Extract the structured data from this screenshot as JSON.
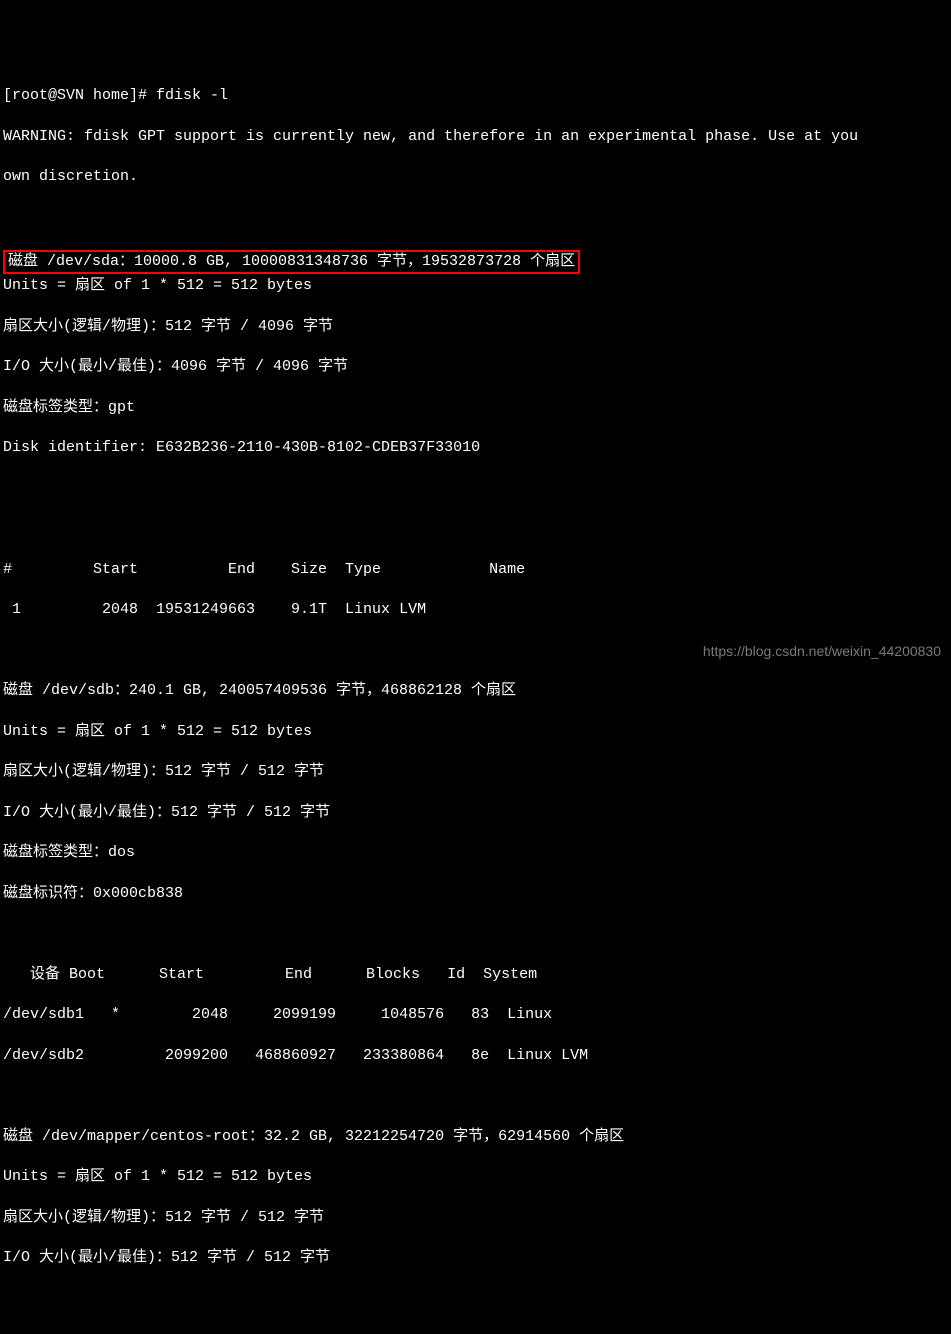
{
  "prompt": "[root@SVN home]# fdisk -l",
  "warning_line1": "WARNING: fdisk GPT support is currently new, and therefore in an experimental phase. Use at you",
  "warning_line2": "own discretion.",
  "sda_header": "磁盘 /dev/sda：10000.8 GB, 10000831348736 字节，19532873728 个扇区",
  "sda_units": "Units = 扇区 of 1 * 512 = 512 bytes",
  "sda_sector": "扇区大小(逻辑/物理)：512 字节 / 4096 字节",
  "sda_io": "I/O 大小(最小/最佳)：4096 字节 / 4096 字节",
  "sda_label": "磁盘标签类型：gpt",
  "sda_identifier": "Disk identifier: E632B236-2110-430B-8102-CDEB37F33010",
  "sda_table_header": "#         Start          End    Size  Type            Name",
  "sda_table_row1": " 1         2048  19531249663    9.1T  Linux LVM",
  "sdb_header": "磁盘 /dev/sdb：240.1 GB, 240057409536 字节，468862128 个扇区",
  "sdb_units": "Units = 扇区 of 1 * 512 = 512 bytes",
  "sdb_sector": "扇区大小(逻辑/物理)：512 字节 / 512 字节",
  "sdb_io": "I/O 大小(最小/最佳)：512 字节 / 512 字节",
  "sdb_label": "磁盘标签类型：dos",
  "sdb_identifier": "磁盘标识符：0x000cb838",
  "sdb_table_header": "   设备 Boot      Start         End      Blocks   Id  System",
  "sdb_table_row1": "/dev/sdb1   *        2048     2099199     1048576   83  Linux",
  "sdb_table_row2": "/dev/sdb2         2099200   468860927   233380864   8e  Linux LVM",
  "mapper_header": "磁盘 /dev/mapper/centos-root：32.2 GB, 32212254720 字节，62914560 个扇区",
  "mapper_units": "Units = 扇区 of 1 * 512 = 512 bytes",
  "mapper_sector": "扇区大小(逻辑/物理)：512 字节 / 512 字节",
  "mapper_io": "I/O 大小(最小/最佳)：512 字节 / 512 字节",
  "watermark": "https://blog.csdn.net/weixin_44200830"
}
